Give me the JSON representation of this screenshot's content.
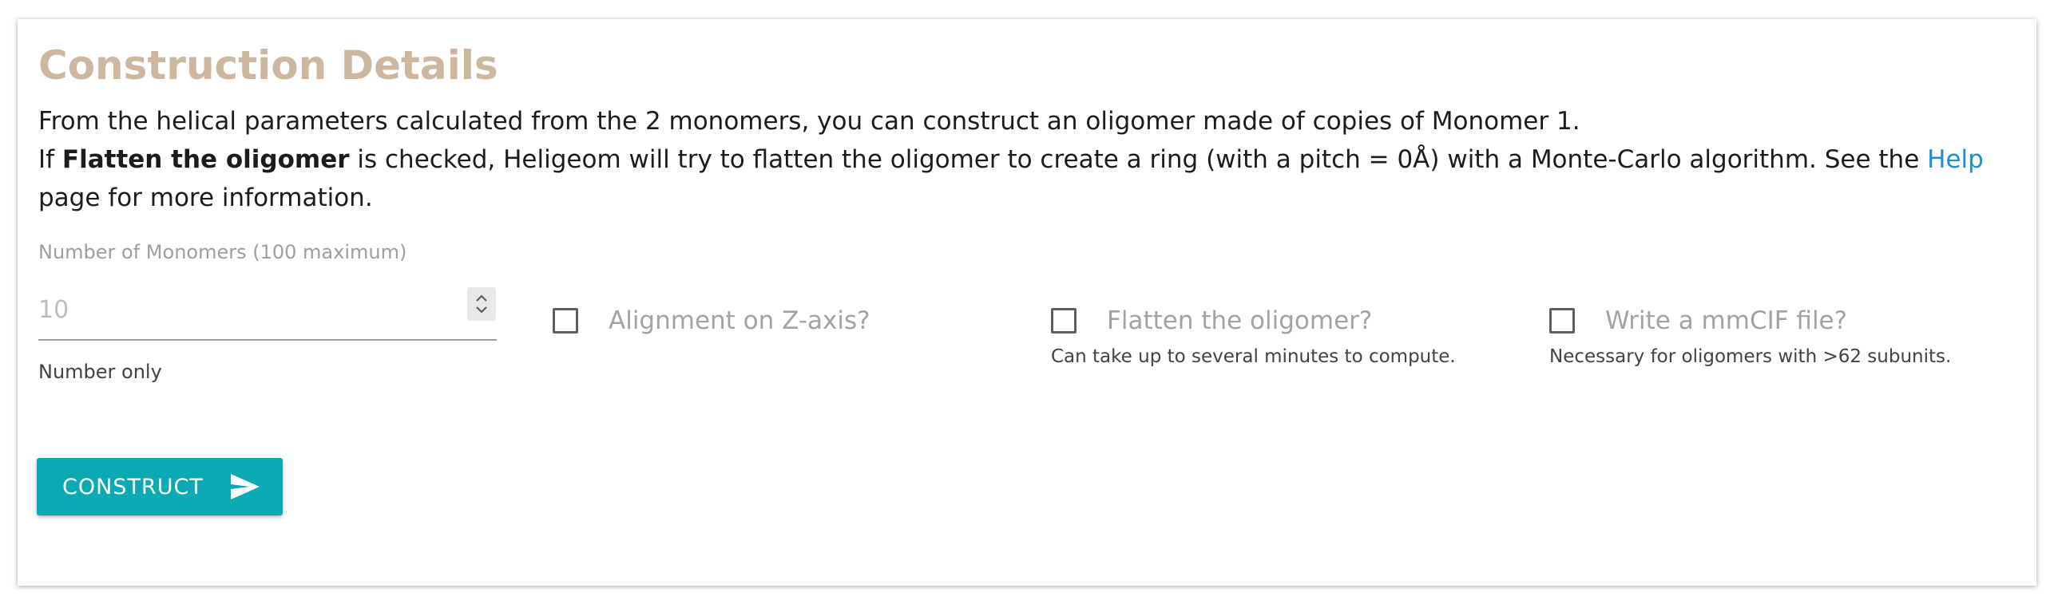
{
  "section": {
    "title": "Construction Details",
    "desc_line1": "From the helical parameters calculated from the 2 monomers, you can construct an oligomer made of copies of Monomer 1.",
    "desc_if": "If ",
    "desc_bold": "Flatten the oligomer",
    "desc_mid": " is checked, Heligeom will try to flatten the oligomer to create a ring (with a pitch = 0Å) with a Monte-Carlo algorithm. See the ",
    "desc_link": "Help",
    "desc_end": " page for more information."
  },
  "monomers_field": {
    "label": "Number of Monomers (100 maximum)",
    "placeholder": "10",
    "value": "",
    "helper": "Number only"
  },
  "options": {
    "z_axis": {
      "label": "Alignment on Z-axis?",
      "checked": false
    },
    "flatten": {
      "label": "Flatten the oligomer?",
      "helper": "Can take up to several minutes to compute.",
      "checked": false
    },
    "mmcif": {
      "label": "Write a mmCIF file?",
      "helper": "Necessary for oligomers with >62 subunits.",
      "checked": false
    }
  },
  "construct_button": {
    "label": "CONSTRUCT",
    "icon": "send-icon"
  },
  "colors": {
    "title": "#cdb79e",
    "link": "#1c8fce",
    "button": "#0aaab5"
  }
}
